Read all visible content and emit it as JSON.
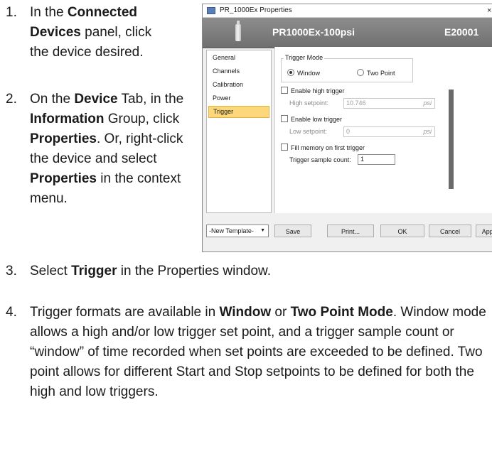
{
  "steps": [
    {
      "num": "1.",
      "parts": [
        "In the ",
        "Connected Devices",
        " panel, click the device desired."
      ]
    },
    {
      "num": "2.",
      "parts": [
        "On the ",
        "Device",
        " Tab, in the ",
        "Information",
        " Group, click ",
        "Properties",
        ". Or, right-click the device and select ",
        "Properties",
        " in the context menu."
      ]
    },
    {
      "num": "3.",
      "parts": [
        "Select ",
        "Trigger",
        " in the Properties window."
      ]
    },
    {
      "num": "4.",
      "parts": [
        "Trigger formats are available in ",
        "Window",
        " or ",
        "Two Point Mode",
        ". Window mode allows a high and/or low trigger set point, and a trigger sample count or “window” of time recorded when set points are exceeded to be defined. Two point allows for different Start and Stop setpoints to be defined for both the high and low triggers."
      ]
    }
  ],
  "dialog": {
    "title": "PR_1000Ex Properties",
    "close_glyph": "×",
    "device_name": "PR1000Ex-100psi",
    "device_serial": "E20001",
    "nav": [
      "General",
      "Channels",
      "Calibration",
      "Power",
      "Trigger"
    ],
    "active_nav": "Trigger",
    "trigger_mode": {
      "label": "Trigger Mode",
      "options": [
        "Window",
        "Two Point"
      ],
      "selected": "Window"
    },
    "high": {
      "enable_label": "Enable high trigger",
      "setpoint_label": "High setpoint:",
      "value": "10.746",
      "unit": "psi"
    },
    "low": {
      "enable_label": "Enable low trigger",
      "setpoint_label": "Low setpoint:",
      "value": "0",
      "unit": "psi"
    },
    "fill_memory_label": "Fill memory on first trigger",
    "sample_count_label": "Trigger sample count:",
    "sample_count_value": "1",
    "template_select": "-New Template-",
    "buttons": {
      "save": "Save",
      "print": "Print...",
      "ok": "OK",
      "cancel": "Cancel",
      "apply": "Apply"
    }
  }
}
